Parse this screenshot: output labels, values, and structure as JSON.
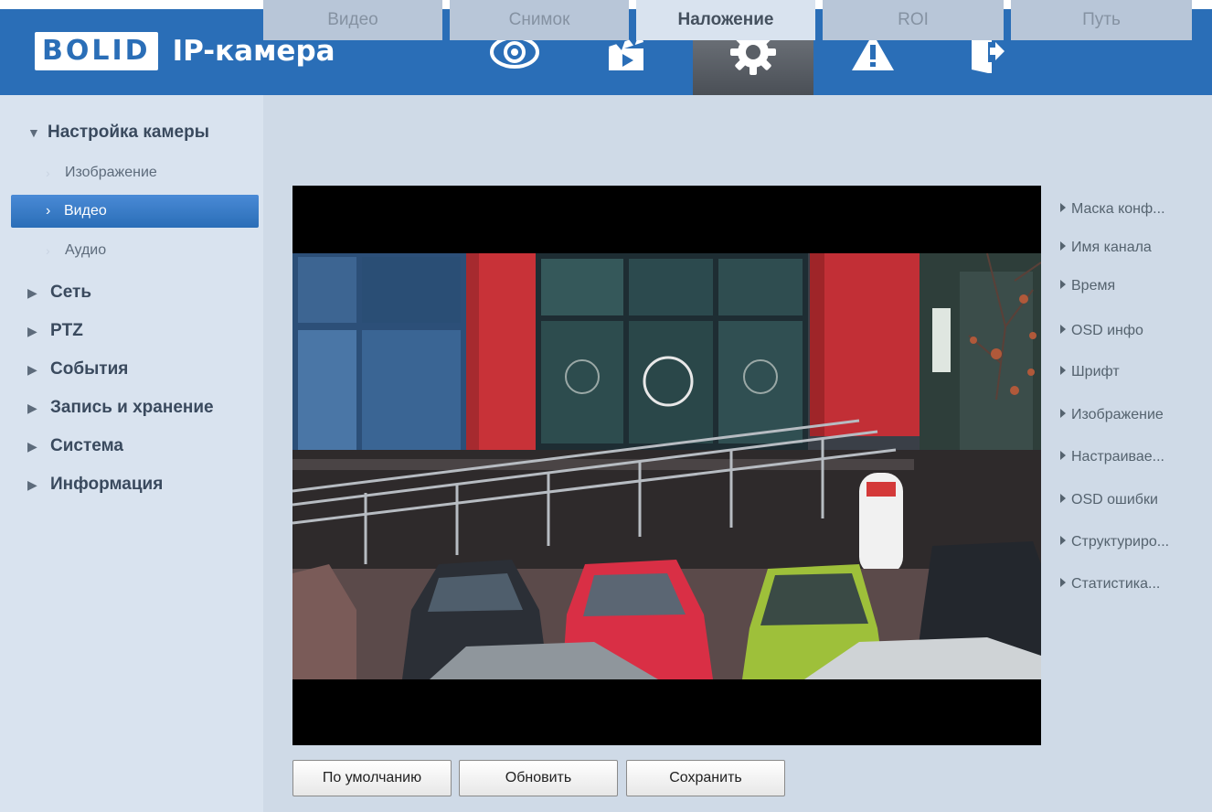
{
  "header": {
    "logo_text": "BOLID",
    "title": "IP-камера",
    "icons": [
      "eye-icon",
      "clapperboard-icon",
      "gear-icon",
      "warning-icon",
      "logout-icon"
    ],
    "active_icon": "gear-icon",
    "accent": "#2a6eb7"
  },
  "sidebar": {
    "items": [
      {
        "label": "Настройка камеры",
        "level": "top",
        "expanded": true
      },
      {
        "label": "Изображение",
        "level": "sub"
      },
      {
        "label": "Видео",
        "level": "sub",
        "active": true
      },
      {
        "label": "Аудио",
        "level": "sub"
      },
      {
        "label": "Сеть",
        "level": "top"
      },
      {
        "label": "PTZ",
        "level": "top"
      },
      {
        "label": "События",
        "level": "top"
      },
      {
        "label": "Запись и хранение",
        "level": "top"
      },
      {
        "label": "Система",
        "level": "top"
      },
      {
        "label": "Информация",
        "level": "top"
      }
    ]
  },
  "tabs": [
    {
      "label": "Видео"
    },
    {
      "label": "Снимок"
    },
    {
      "label": "Наложение",
      "active": true
    },
    {
      "label": "ROI"
    },
    {
      "label": "Путь"
    }
  ],
  "overlay_options": [
    "Маска конф...",
    "Имя канала",
    "Время",
    "OSD инфо",
    "Шрифт",
    "Изображение",
    "Настраивае...",
    "OSD ошибки",
    "Структуриро...",
    "Статистика..."
  ],
  "buttons": {
    "default": "По умолчанию",
    "refresh": "Обновить",
    "save": "Сохранить"
  }
}
